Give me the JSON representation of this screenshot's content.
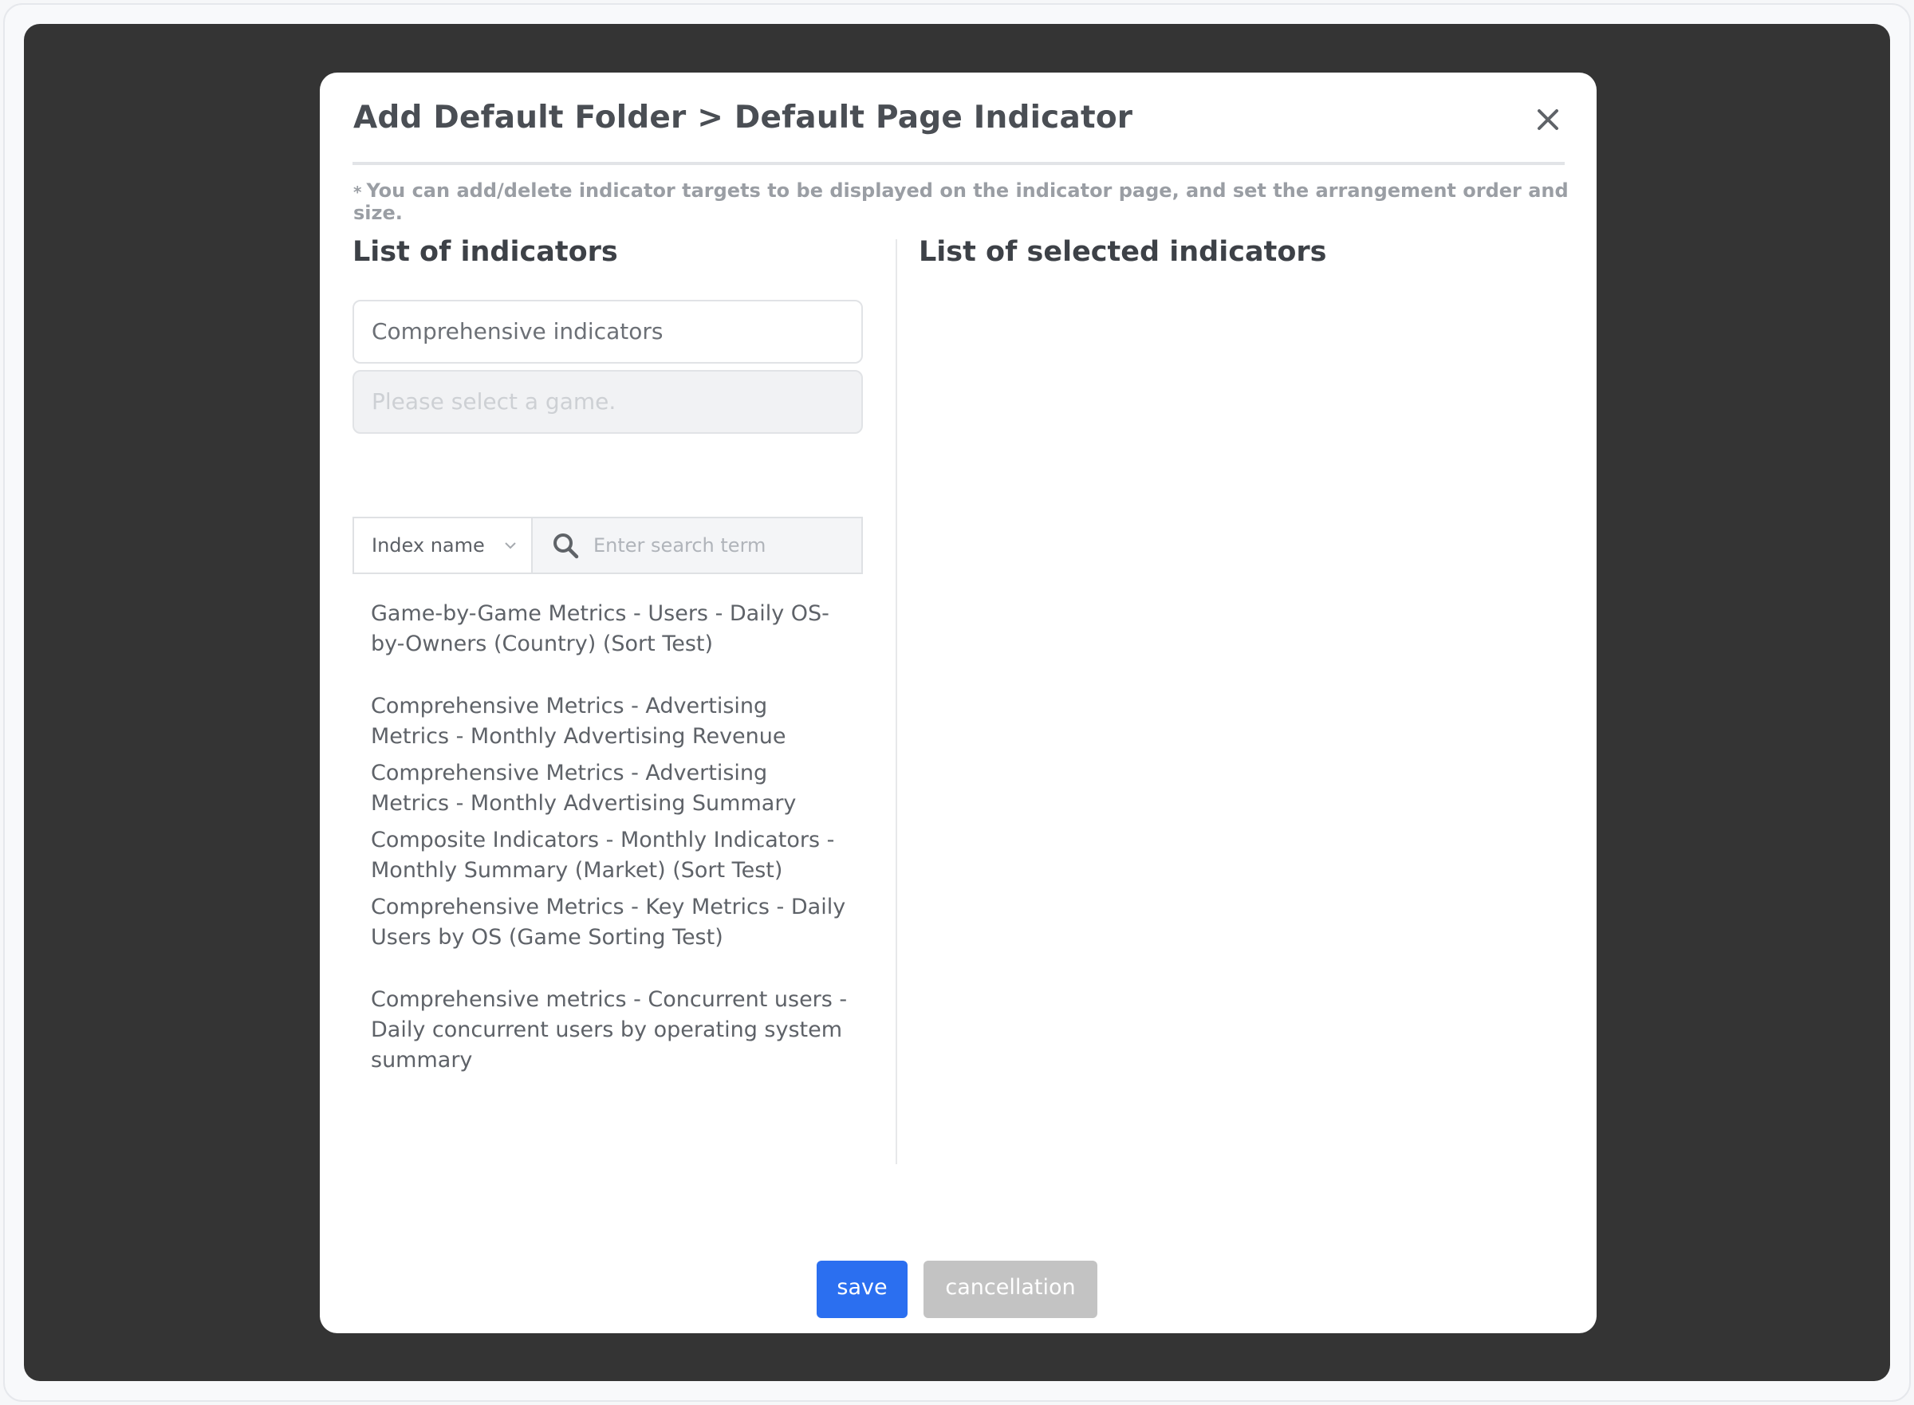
{
  "modal": {
    "title": "Add Default Folder > Default Page Indicator",
    "note_star": "*",
    "note": "You can add/delete indicator targets to be displayed on the indicator page, and set the arrangement order and size."
  },
  "left": {
    "title": "List of indicators",
    "category_value": "Comprehensive indicators",
    "game_placeholder": "Please select a game.",
    "search_field_option": "Index name",
    "search_placeholder": "Enter search term",
    "items": [
      "Game-by-Game Metrics - Users - Daily OS-by-Owners (Country) (Sort Test)",
      "Comprehensive Metrics - Advertising Metrics - Monthly Advertising Revenue",
      "Comprehensive Metrics - Advertising Metrics - Monthly Advertising Summary",
      "Composite Indicators - Monthly Indicators - Monthly Summary (Market) (Sort Test)",
      "Comprehensive Metrics - Key Metrics - Daily Users by OS (Game Sorting Test)",
      "Comprehensive metrics - Concurrent users - Daily concurrent users by operating system summary"
    ]
  },
  "right": {
    "title": "List of selected indicators"
  },
  "footer": {
    "save_label": "save",
    "cancel_label": "cancellation"
  },
  "colors": {
    "overlay": "#343434",
    "save_button": "#2b6ff0",
    "cancel_button": "#c3c3c3"
  }
}
